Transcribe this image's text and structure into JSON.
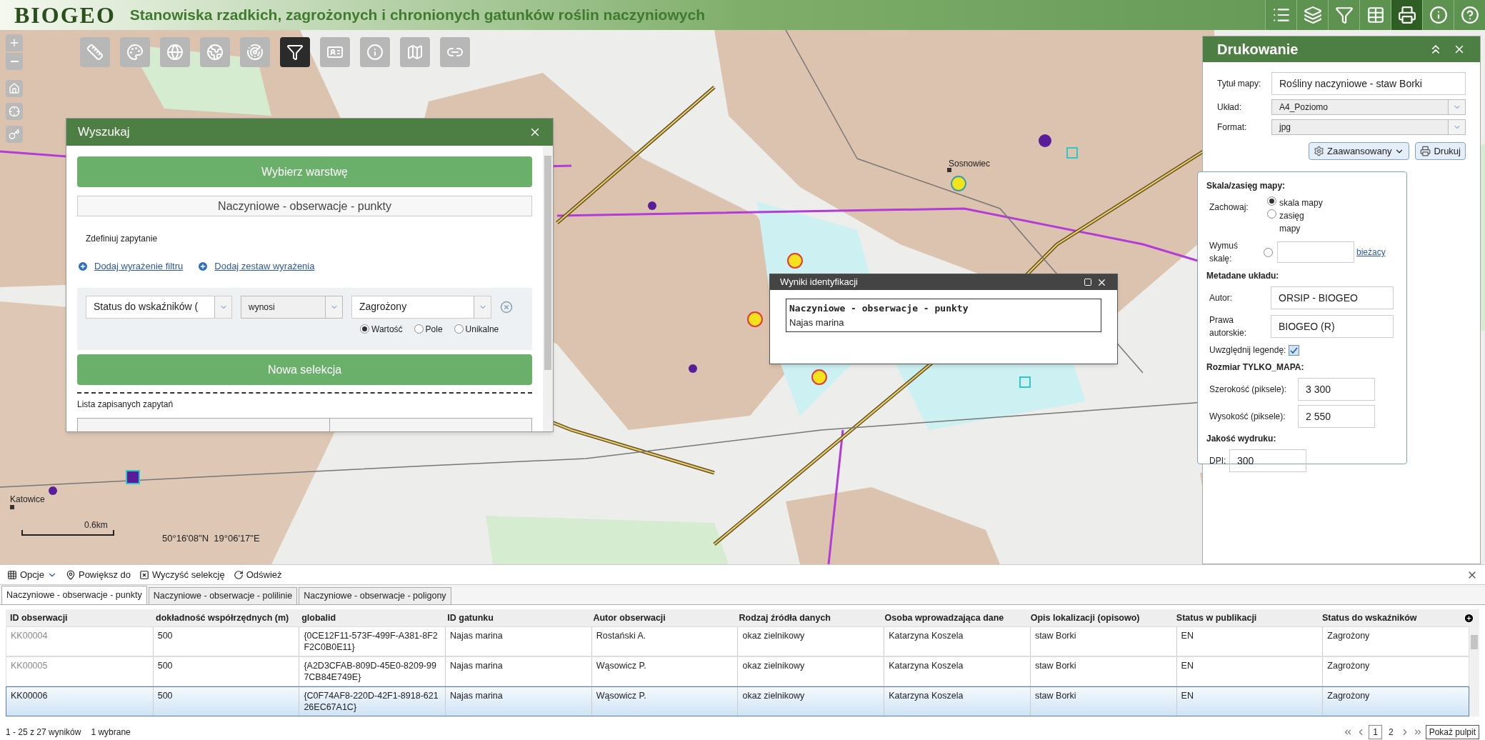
{
  "header": {
    "logo": "BIOGEO",
    "title": "Stanowiska rzadkich, zagrożonych i chronionych gatunków roślin naczyniowych"
  },
  "header_tools": [
    {
      "kind": "list",
      "selected": false
    },
    {
      "kind": "layers",
      "selected": false
    },
    {
      "kind": "filter",
      "selected": false
    },
    {
      "kind": "table",
      "selected": false
    },
    {
      "kind": "print",
      "selected": true
    },
    {
      "kind": "info",
      "selected": false
    },
    {
      "kind": "help",
      "selected": false
    }
  ],
  "map_tools": [
    {
      "kind": "ruler",
      "selected": false
    },
    {
      "kind": "palette",
      "selected": false
    },
    {
      "kind": "globe",
      "selected": false
    },
    {
      "kind": "earth",
      "selected": false
    },
    {
      "kind": "radar",
      "selected": false
    },
    {
      "kind": "filter",
      "selected": true
    },
    {
      "kind": "card",
      "selected": false
    },
    {
      "kind": "info",
      "selected": false
    },
    {
      "kind": "map",
      "selected": false
    },
    {
      "kind": "link",
      "selected": false
    }
  ],
  "map": {
    "places": [
      "Sosnowiec",
      "Katowice"
    ],
    "scale": "0.6km",
    "coordinates": "50°16'08\"N  19°06'17\"E"
  },
  "search_panel": {
    "title": "Wyszukaj",
    "layer_button": "Wybierz warstwę",
    "layer": "Naczyniowe - obserwacje - punkty",
    "define": "Zdefiniuj zapytanie",
    "links": [
      "Dodaj wyrażenie filtru",
      "Dodaj zestaw wyrażenia"
    ],
    "field": "Status do wskaźników (",
    "operator": "wynosi",
    "value": "Zagrożony",
    "radios": [
      {
        "label": "Wartość",
        "selected": true
      },
      {
        "label": "Pole",
        "selected": false
      },
      {
        "label": "Unikalne",
        "selected": false
      }
    ],
    "new_selection": "Nowa selekcja",
    "saved": "Lista zapisanych zapytań"
  },
  "identify_popup": {
    "title": "Wyniki identyfikacji",
    "layer": "Naczyniowe - obserwacje - punkty",
    "feature": "Najas marina"
  },
  "print_panel": {
    "title": "Drukowanie",
    "fields": [
      {
        "label": "Tytuł mapy:",
        "value": "Rośliny naczyniowe - staw Borki",
        "kind": "text"
      },
      {
        "label": "Układ:",
        "value": "A4_Poziomo",
        "kind": "select"
      },
      {
        "label": "Format:",
        "value": "jpg",
        "kind": "select"
      }
    ],
    "advanced_button": "Zaawansowany",
    "print_button": "Drukuj",
    "advanced": {
      "scale_heading": "Skala/zasięg mapy:",
      "keep_label": "Zachowaj:",
      "keep_options": [
        {
          "label": "skala mapy",
          "selected": true
        },
        {
          "label": "zasięg mapy",
          "selected": false
        }
      ],
      "force_label": "Wymuś skalę:",
      "force_selected": false,
      "current_link": "bieżacy",
      "meta_heading": "Metadane układu:",
      "meta": [
        {
          "label": "Autor:",
          "value": "ORSIP - BIOGEO"
        },
        {
          "label": "Prawa autorskie:",
          "value": "BIOGEO (R)"
        }
      ],
      "legend_label": "Uwzględnij legendę:",
      "legend_checked": true,
      "size_heading": "Rozmiar TYLKO_MAPA:",
      "size": [
        {
          "label": "Szerokość (piksele):",
          "value": "3 300"
        },
        {
          "label": "Wysokość (piksele):",
          "value": "2 550"
        }
      ],
      "quality_heading": "Jakość wydruku:",
      "dpi_label": "DPI:",
      "dpi": "300"
    }
  },
  "attribute_table": {
    "toolbar": [
      "Opcje",
      "Powiększ do",
      "Wyczyść selekcję",
      "Odśwież"
    ],
    "tabs": [
      {
        "label": "Naczyniowe - obserwacje - punkty",
        "selected": true
      },
      {
        "label": "Naczyniowe - obserwacje - polilinie",
        "selected": false
      },
      {
        "label": "Naczyniowe - obserwacje - poligony",
        "selected": false
      }
    ],
    "columns": [
      "ID obserwacji",
      "dokładność współrzędnych (m)",
      "globalid",
      "ID gatunku",
      "Autor obserwacji",
      "Rodzaj źródła danych",
      "Osoba wprowadzająca dane",
      "Opis lokalizacji (opisowo)",
      "Status w publikacji",
      "Status do wskaźników"
    ],
    "rows": [
      {
        "selected": false,
        "cells": [
          "KK00004",
          "500",
          "{0CE12F11-573F-499F-A381-8F2F2C0B0E11}",
          "Najas marina",
          "Rostański A.",
          "okaz zielnikowy",
          "Katarzyna Koszela",
          "staw Borki",
          "EN",
          "Zagrożony"
        ]
      },
      {
        "selected": false,
        "cells": [
          "KK00005",
          "500",
          "{A2D3CFAB-809D-45E0-8209-997CB84E749E}",
          "Najas marina",
          "Wąsowicz P.",
          "okaz zielnikowy",
          "Katarzyna Koszela",
          "staw Borki",
          "EN",
          "Zagrożony"
        ]
      },
      {
        "selected": true,
        "cells": [
          "KK00006",
          "500",
          "{C0F74AF8-220D-42F1-8918-62126EC67A1C}",
          "Najas marina",
          "Wąsowicz P.",
          "okaz zielnikowy",
          "Katarzyna Koszela",
          "staw Borki",
          "EN",
          "Zagrożony"
        ]
      }
    ],
    "status": "1 - 25 z 27 wyników",
    "selected_count": "1 wybrane",
    "pages": [
      {
        "label": "1",
        "selected": true
      },
      {
        "label": "2",
        "selected": false
      }
    ],
    "tooltip": "Pokaż pulpit"
  }
}
